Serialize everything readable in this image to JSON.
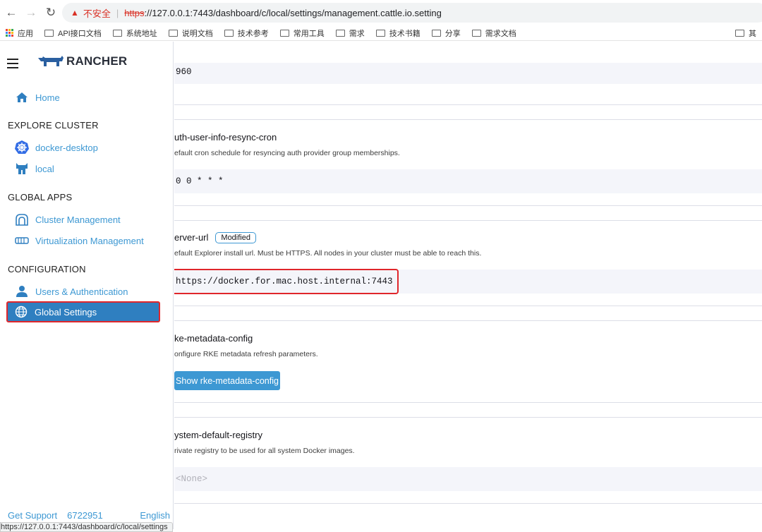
{
  "browser": {
    "insecure_label": "不安全",
    "url_scheme": "https",
    "url_rest": "://127.0.0.1:7443/dashboard/c/local/settings/management.cattle.io.setting",
    "status_url": "https://127.0.0.1:7443/dashboard/c/local/settings"
  },
  "bookmarks": [
    {
      "label": "应用"
    },
    {
      "label": "API接口文档"
    },
    {
      "label": "系统地址"
    },
    {
      "label": "说明文档"
    },
    {
      "label": "技术参考"
    },
    {
      "label": "常用工具"
    },
    {
      "label": "需求"
    },
    {
      "label": "技术书籍"
    },
    {
      "label": "分享"
    },
    {
      "label": "需求文档"
    },
    {
      "label": "其"
    }
  ],
  "sidebar": {
    "logo_text": "RANCHER",
    "home": "Home",
    "explore_cluster": "EXPLORE CLUSTER",
    "clusters": [
      "docker-desktop",
      "local"
    ],
    "global_apps": "GLOBAL APPS",
    "apps": [
      "Cluster Management",
      "Virtualization Management"
    ],
    "configuration": "CONFIGURATION",
    "config_items": [
      "Users & Authentication",
      "Global Settings"
    ],
    "footer": {
      "support": "Get Support",
      "version": "6722951",
      "lang": "English"
    }
  },
  "settings": {
    "prev_value": "960",
    "s1": {
      "name": "uth-user-info-resync-cron",
      "desc": "efault cron schedule for resyncing auth provider group memberships.",
      "value": "0 0 * * *"
    },
    "s2": {
      "name": "erver-url",
      "badge": "Modified",
      "desc": "efault Explorer install url. Must be HTTPS. All nodes in your cluster must be able to reach this.",
      "value": "https://docker.for.mac.host.internal:7443"
    },
    "s3": {
      "name": "ke-metadata-config",
      "desc": "onfigure RKE metadata refresh parameters.",
      "button": "Show rke-metadata-config"
    },
    "s4": {
      "name": "ystem-default-registry",
      "desc": "rivate registry to be used for all system Docker images.",
      "value": "<None>"
    }
  },
  "colors": {
    "accent": "#3d98d3",
    "active_bg": "#2f7fc0",
    "highlight": "#e0262b"
  }
}
